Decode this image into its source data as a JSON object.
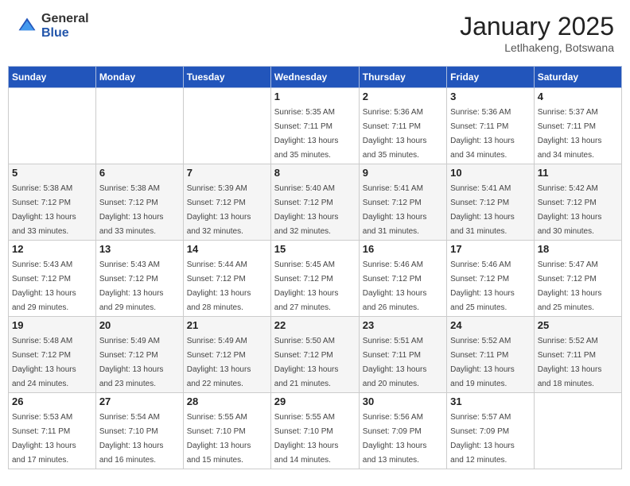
{
  "header": {
    "logo_general": "General",
    "logo_blue": "Blue",
    "month_title": "January 2025",
    "location": "Letlhakeng, Botswana"
  },
  "weekdays": [
    "Sunday",
    "Monday",
    "Tuesday",
    "Wednesday",
    "Thursday",
    "Friday",
    "Saturday"
  ],
  "weeks": [
    [
      {
        "day": "",
        "info": ""
      },
      {
        "day": "",
        "info": ""
      },
      {
        "day": "",
        "info": ""
      },
      {
        "day": "1",
        "info": "Sunrise: 5:35 AM\nSunset: 7:11 PM\nDaylight: 13 hours\nand 35 minutes."
      },
      {
        "day": "2",
        "info": "Sunrise: 5:36 AM\nSunset: 7:11 PM\nDaylight: 13 hours\nand 35 minutes."
      },
      {
        "day": "3",
        "info": "Sunrise: 5:36 AM\nSunset: 7:11 PM\nDaylight: 13 hours\nand 34 minutes."
      },
      {
        "day": "4",
        "info": "Sunrise: 5:37 AM\nSunset: 7:11 PM\nDaylight: 13 hours\nand 34 minutes."
      }
    ],
    [
      {
        "day": "5",
        "info": "Sunrise: 5:38 AM\nSunset: 7:12 PM\nDaylight: 13 hours\nand 33 minutes."
      },
      {
        "day": "6",
        "info": "Sunrise: 5:38 AM\nSunset: 7:12 PM\nDaylight: 13 hours\nand 33 minutes."
      },
      {
        "day": "7",
        "info": "Sunrise: 5:39 AM\nSunset: 7:12 PM\nDaylight: 13 hours\nand 32 minutes."
      },
      {
        "day": "8",
        "info": "Sunrise: 5:40 AM\nSunset: 7:12 PM\nDaylight: 13 hours\nand 32 minutes."
      },
      {
        "day": "9",
        "info": "Sunrise: 5:41 AM\nSunset: 7:12 PM\nDaylight: 13 hours\nand 31 minutes."
      },
      {
        "day": "10",
        "info": "Sunrise: 5:41 AM\nSunset: 7:12 PM\nDaylight: 13 hours\nand 31 minutes."
      },
      {
        "day": "11",
        "info": "Sunrise: 5:42 AM\nSunset: 7:12 PM\nDaylight: 13 hours\nand 30 minutes."
      }
    ],
    [
      {
        "day": "12",
        "info": "Sunrise: 5:43 AM\nSunset: 7:12 PM\nDaylight: 13 hours\nand 29 minutes."
      },
      {
        "day": "13",
        "info": "Sunrise: 5:43 AM\nSunset: 7:12 PM\nDaylight: 13 hours\nand 29 minutes."
      },
      {
        "day": "14",
        "info": "Sunrise: 5:44 AM\nSunset: 7:12 PM\nDaylight: 13 hours\nand 28 minutes."
      },
      {
        "day": "15",
        "info": "Sunrise: 5:45 AM\nSunset: 7:12 PM\nDaylight: 13 hours\nand 27 minutes."
      },
      {
        "day": "16",
        "info": "Sunrise: 5:46 AM\nSunset: 7:12 PM\nDaylight: 13 hours\nand 26 minutes."
      },
      {
        "day": "17",
        "info": "Sunrise: 5:46 AM\nSunset: 7:12 PM\nDaylight: 13 hours\nand 25 minutes."
      },
      {
        "day": "18",
        "info": "Sunrise: 5:47 AM\nSunset: 7:12 PM\nDaylight: 13 hours\nand 25 minutes."
      }
    ],
    [
      {
        "day": "19",
        "info": "Sunrise: 5:48 AM\nSunset: 7:12 PM\nDaylight: 13 hours\nand 24 minutes."
      },
      {
        "day": "20",
        "info": "Sunrise: 5:49 AM\nSunset: 7:12 PM\nDaylight: 13 hours\nand 23 minutes."
      },
      {
        "day": "21",
        "info": "Sunrise: 5:49 AM\nSunset: 7:12 PM\nDaylight: 13 hours\nand 22 minutes."
      },
      {
        "day": "22",
        "info": "Sunrise: 5:50 AM\nSunset: 7:12 PM\nDaylight: 13 hours\nand 21 minutes."
      },
      {
        "day": "23",
        "info": "Sunrise: 5:51 AM\nSunset: 7:11 PM\nDaylight: 13 hours\nand 20 minutes."
      },
      {
        "day": "24",
        "info": "Sunrise: 5:52 AM\nSunset: 7:11 PM\nDaylight: 13 hours\nand 19 minutes."
      },
      {
        "day": "25",
        "info": "Sunrise: 5:52 AM\nSunset: 7:11 PM\nDaylight: 13 hours\nand 18 minutes."
      }
    ],
    [
      {
        "day": "26",
        "info": "Sunrise: 5:53 AM\nSunset: 7:11 PM\nDaylight: 13 hours\nand 17 minutes."
      },
      {
        "day": "27",
        "info": "Sunrise: 5:54 AM\nSunset: 7:10 PM\nDaylight: 13 hours\nand 16 minutes."
      },
      {
        "day": "28",
        "info": "Sunrise: 5:55 AM\nSunset: 7:10 PM\nDaylight: 13 hours\nand 15 minutes."
      },
      {
        "day": "29",
        "info": "Sunrise: 5:55 AM\nSunset: 7:10 PM\nDaylight: 13 hours\nand 14 minutes."
      },
      {
        "day": "30",
        "info": "Sunrise: 5:56 AM\nSunset: 7:09 PM\nDaylight: 13 hours\nand 13 minutes."
      },
      {
        "day": "31",
        "info": "Sunrise: 5:57 AM\nSunset: 7:09 PM\nDaylight: 13 hours\nand 12 minutes."
      },
      {
        "day": "",
        "info": ""
      }
    ]
  ]
}
